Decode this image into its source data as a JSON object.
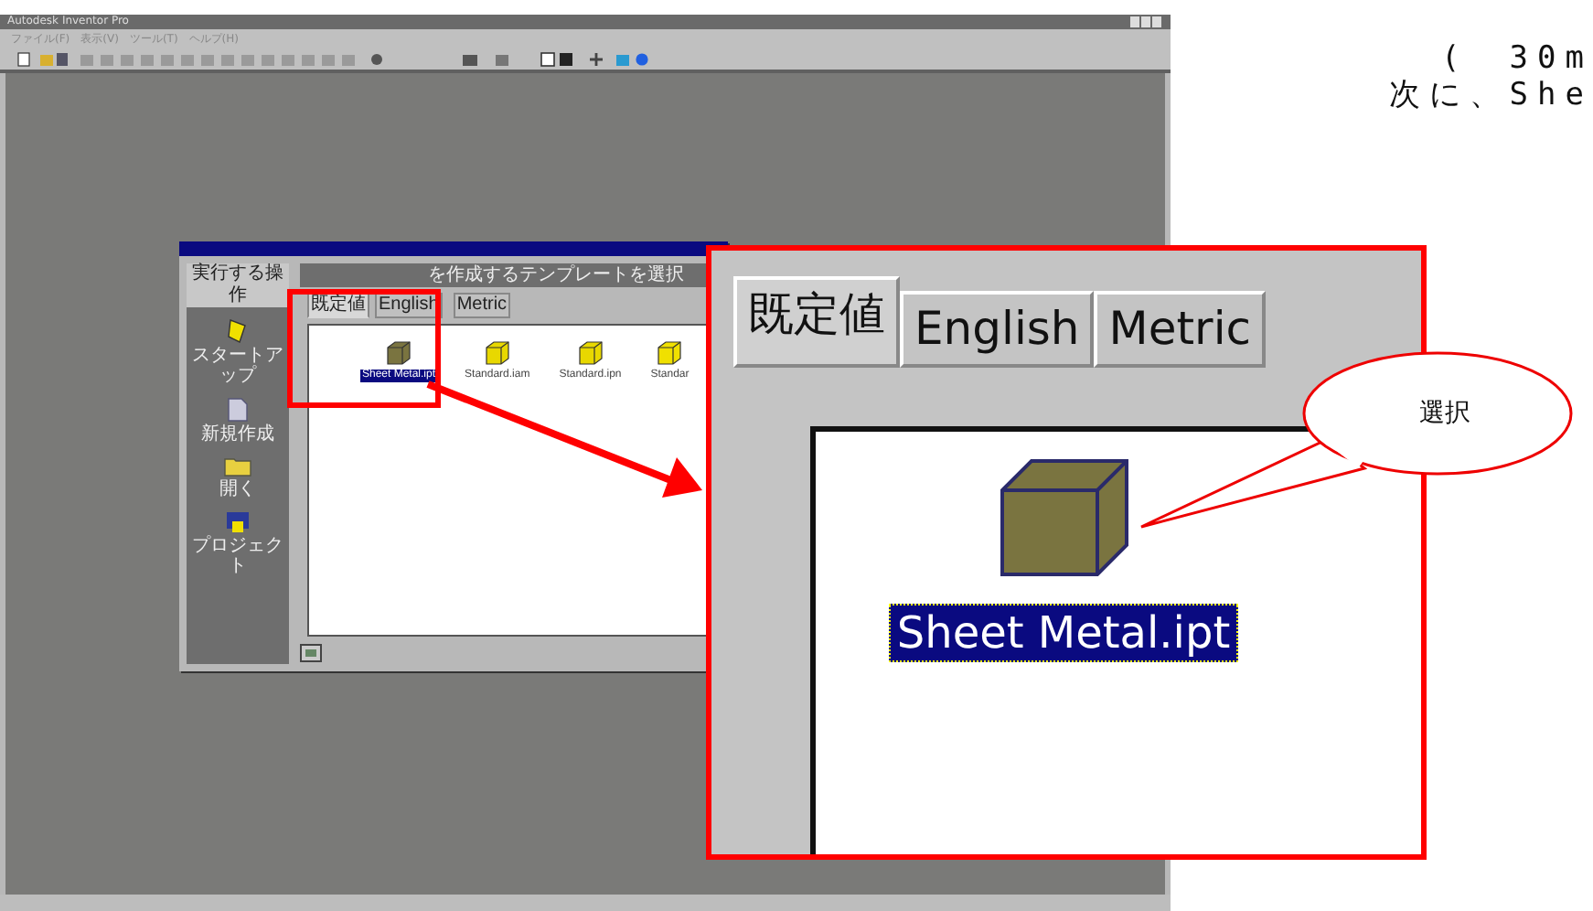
{
  "window": {
    "title": "Autodesk Inventor Pro"
  },
  "menu": [
    "ファイル(F)",
    "表示(V)",
    "ツール(T)",
    "ヘルプ(H)"
  ],
  "dialog": {
    "actions_header": "実行する操作",
    "actions": [
      {
        "label": "スタートアップ",
        "kind": "startup"
      },
      {
        "label": "新規作成",
        "kind": "new"
      },
      {
        "label": "開く",
        "kind": "open"
      },
      {
        "label": "プロジェクト",
        "kind": "project"
      }
    ],
    "header": "を作成するテンプレートを選択",
    "tabs": [
      {
        "label": "既定値",
        "selected": true
      },
      {
        "label": "English",
        "selected": false
      },
      {
        "label": "Metric",
        "selected": false
      }
    ],
    "templates": [
      {
        "label": "Sheet Metal.ipt",
        "kind": "sheet",
        "selected": true
      },
      {
        "label": "Standard.iam",
        "kind": "assembly",
        "selected": false
      },
      {
        "label": "Standard.ipn",
        "kind": "presentation",
        "selected": false
      },
      {
        "label": "Standar",
        "kind": "part",
        "selected": false
      }
    ]
  },
  "zoom_callout": {
    "tabs": [
      {
        "label": "既定値",
        "selected": true
      },
      {
        "label": "English",
        "selected": false
      },
      {
        "label": "Metric",
        "selected": false
      }
    ],
    "template": {
      "label": "Sheet Metal.ipt",
      "selected": true
    },
    "balloon": "選択"
  },
  "document_text": [
    "(　30m",
    "次に、She"
  ]
}
